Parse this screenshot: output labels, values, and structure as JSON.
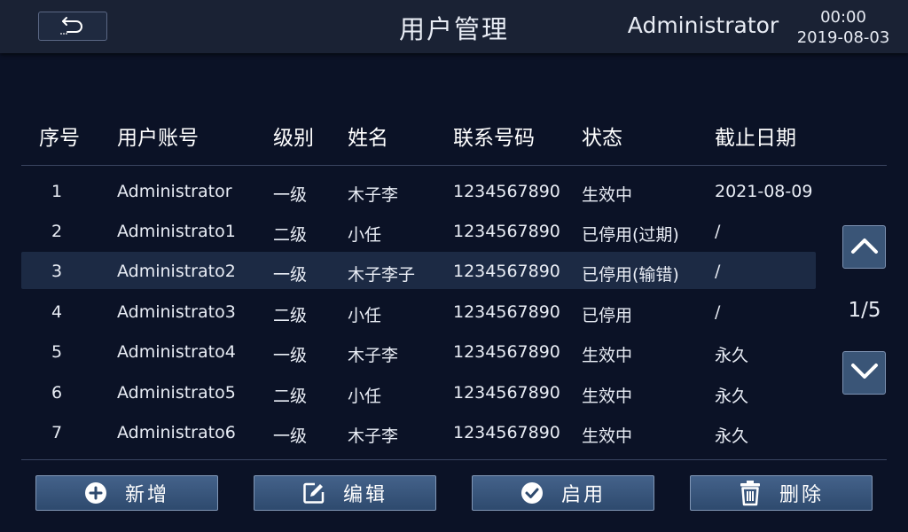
{
  "header": {
    "title": "用户管理",
    "user": "Administrator",
    "time": "00:00",
    "date": "2019-08-03",
    "back_icon": "back-arrow-icon"
  },
  "table": {
    "columns": [
      "序号",
      "用户账号",
      "级别",
      "姓名",
      "联系号码",
      "状态",
      "截止日期"
    ],
    "rows": [
      {
        "idx": "1",
        "account": "Administrator",
        "level": "一级",
        "name": "木子李",
        "phone": "1234567890",
        "status": "生效中",
        "expire": "2021-08-09"
      },
      {
        "idx": "2",
        "account": "Administrato1",
        "level": "二级",
        "name": "小任",
        "phone": "1234567890",
        "status": "已停用(过期)",
        "expire": "/"
      },
      {
        "idx": "3",
        "account": "Administrato2",
        "level": "一级",
        "name": "木子李子",
        "phone": "1234567890",
        "status": "已停用(输错)",
        "expire": "/"
      },
      {
        "idx": "4",
        "account": "Administrato3",
        "level": "二级",
        "name": "小任",
        "phone": "1234567890",
        "status": "已停用",
        "expire": "/"
      },
      {
        "idx": "5",
        "account": "Administrato4",
        "level": "一级",
        "name": "木子李",
        "phone": "1234567890",
        "status": "生效中",
        "expire": "永久"
      },
      {
        "idx": "6",
        "account": "Administrato5",
        "level": "二级",
        "name": "小任",
        "phone": "1234567890",
        "status": "生效中",
        "expire": "永久"
      },
      {
        "idx": "7",
        "account": "Administrato6",
        "level": "一级",
        "name": "木子李",
        "phone": "1234567890",
        "status": "生效中",
        "expire": "永久"
      }
    ],
    "selected_row": "3"
  },
  "pager": {
    "text": "1/5"
  },
  "actions": {
    "add": "新增",
    "edit": "编辑",
    "enable": "启用",
    "delete": "删除"
  },
  "colors": {
    "background": "#0b1226",
    "topbar": "#1a2234",
    "button": "#3a5577",
    "selected_row": "#1c2a44"
  }
}
